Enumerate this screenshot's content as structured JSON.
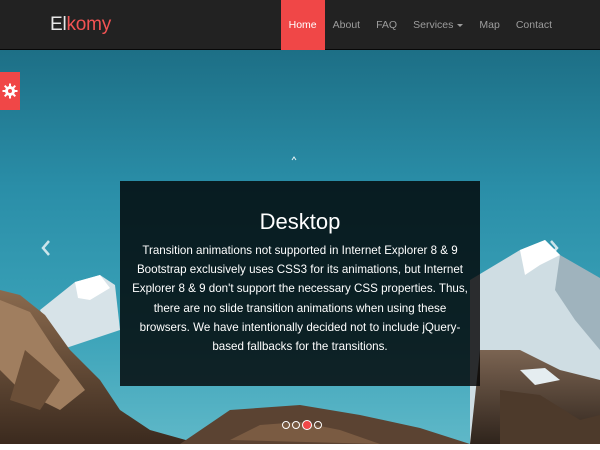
{
  "brand": {
    "part1": "El",
    "part2": "komy",
    "part1_color": "#e8e8e8",
    "part2_color": "#f25353"
  },
  "nav": {
    "items": [
      {
        "label": "Home",
        "active": true
      },
      {
        "label": "About",
        "active": false
      },
      {
        "label": "FAQ",
        "active": false
      },
      {
        "label": "Services",
        "active": false,
        "dropdown": true
      },
      {
        "label": "Map",
        "active": false
      },
      {
        "label": "Contact",
        "active": false
      }
    ]
  },
  "carousel": {
    "title": "Desktop",
    "text": "Transition animations not supported in Internet Explorer 8 & 9 Bootstrap exclusively uses CSS3 for its animations, but Internet Explorer 8 & 9 don't support the necessary CSS properties. Thus, there are no slide transition animations when using these browsers. We have intentionally decided not to include jQuery-based fallbacks for the transitions.",
    "prev_icon": "chevron-left-icon",
    "next_icon": "chevron-right-icon",
    "slide_count": 4,
    "active_slide": 3
  },
  "colors": {
    "accent": "#f04747",
    "navbar_bg": "#222222",
    "nav_text": "#9d9d9d",
    "sky": "#2a8ea8"
  },
  "settings": {
    "icon": "gear-icon"
  }
}
